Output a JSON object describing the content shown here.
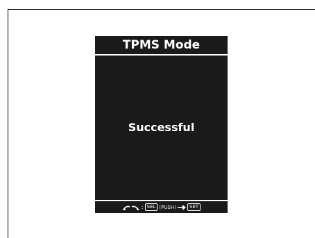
{
  "screen": {
    "title": "TPMS Mode",
    "message": "Successful"
  },
  "footer": {
    "separator": ":",
    "sel_label": "SEL",
    "push_label": "(PUSH)",
    "set_label": "SET",
    "icons": [
      "scroll-arrows-icon",
      "arrow-right-icon"
    ]
  },
  "colors": {
    "display_bg": "#1a1a1a",
    "text": "#ffffff",
    "page_bg": "#ffffff"
  }
}
